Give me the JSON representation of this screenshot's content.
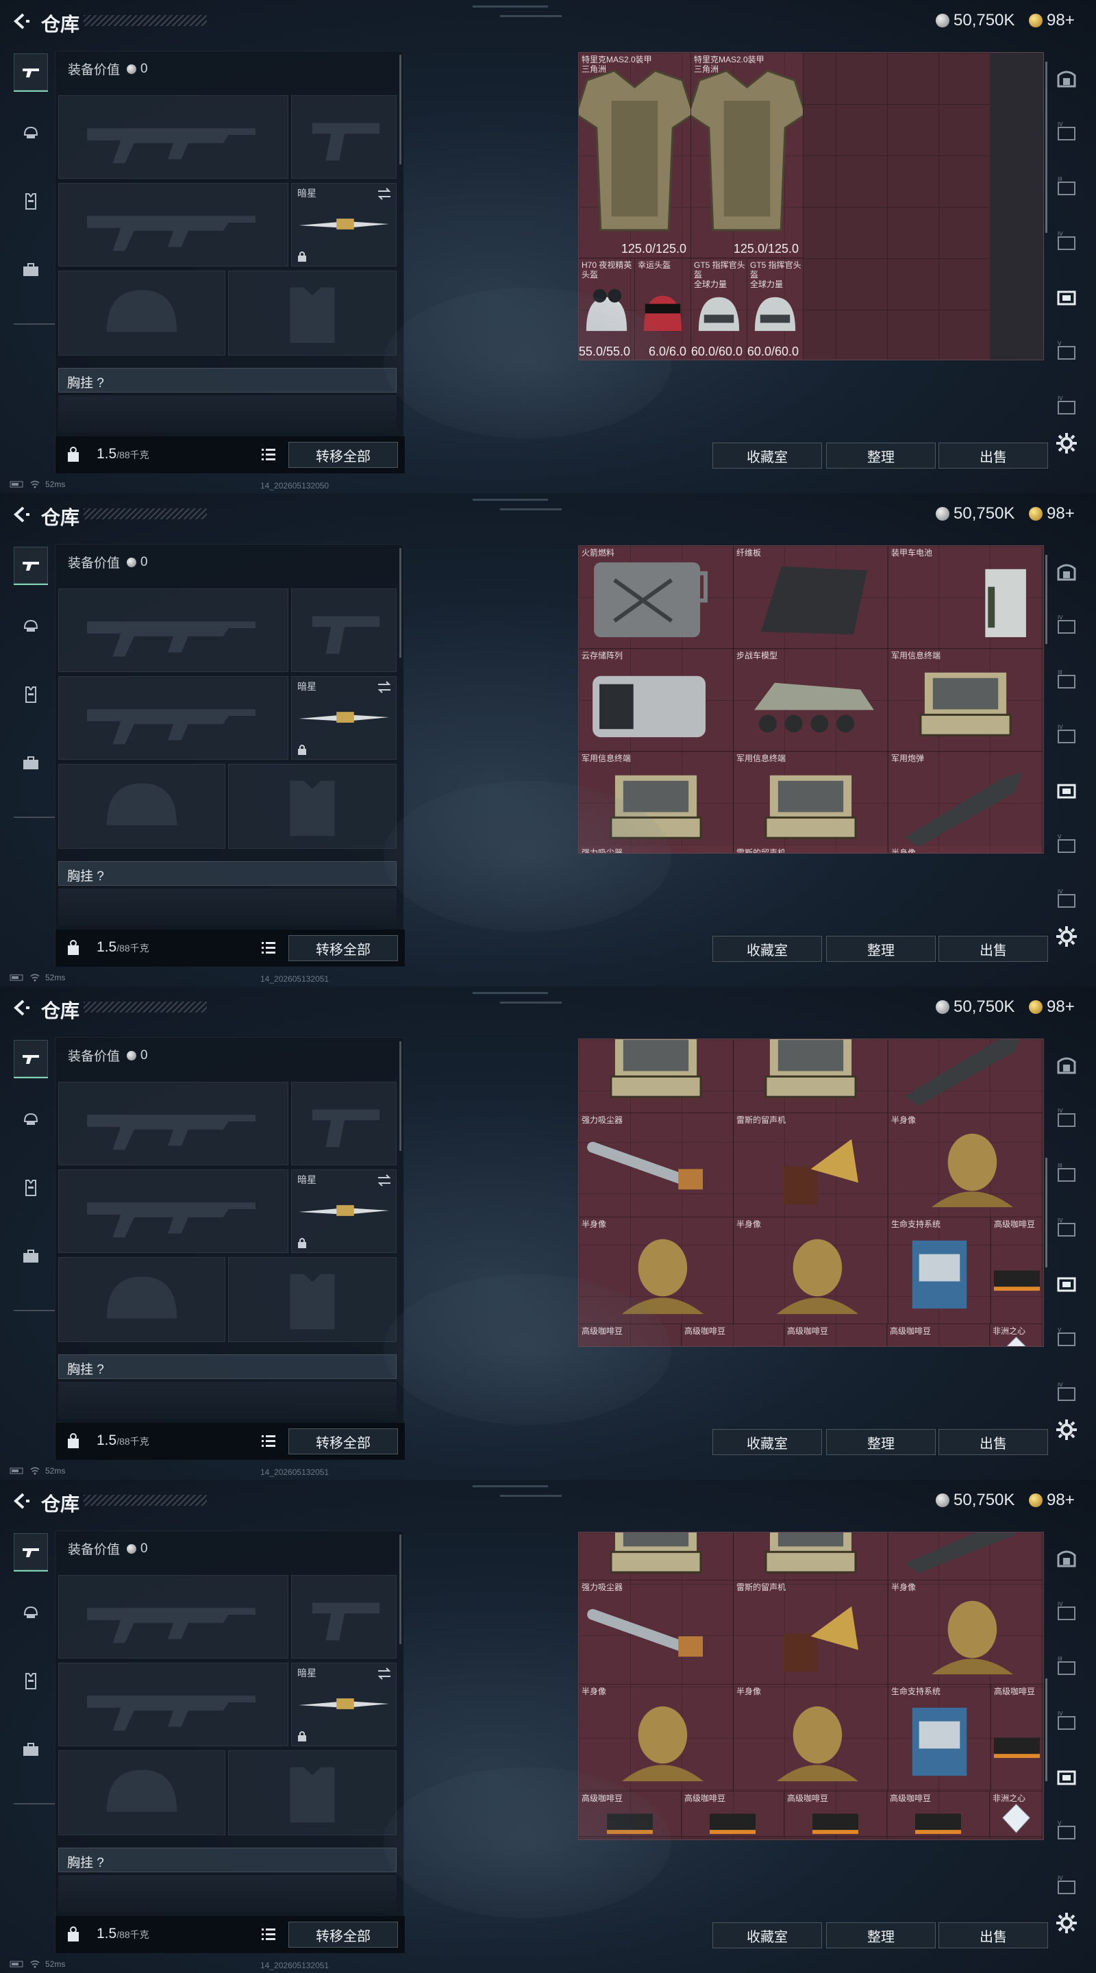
{
  "colors": {
    "grid_bg": "#4c2a33",
    "accent_green": "#7fd3b4",
    "button_bg": "#1c2630"
  },
  "topbar": {
    "title": "仓库",
    "silver": "50,750K",
    "gold": "98+"
  },
  "equipment": {
    "value_label": "装备价值",
    "value": "0",
    "slot_secondary_name": "暗星",
    "chest_label": "胸挂 ?",
    "weight_value": "1.5",
    "weight_unit": "/88千克",
    "transfer_all": "转移全部"
  },
  "actions": {
    "collection": "收藏室",
    "organize": "整理",
    "sell": "出售"
  },
  "status": {
    "ping": "52ms"
  },
  "builds": [
    "14_202605132050",
    "14_202605132051",
    "14_202605132051",
    "14_202605132051"
  ],
  "icons": {
    "back": "back-arrow-icon",
    "nav": [
      "rifle-icon",
      "helmet-icon",
      "armor-icon",
      "backpack-icon"
    ],
    "settings": "gear-icon"
  },
  "screens": [
    {
      "items": [
        {
          "name": "特里克MAS2.0装甲\n三角洲",
          "dur": "125.0/125.0",
          "art": "armor"
        },
        {
          "name": "特里克MAS2.0装甲\n三角洲",
          "dur": "125.0/125.0",
          "art": "armor"
        },
        {
          "name": "H70 夜视精英头盔",
          "dur": "55.0/55.0",
          "art": "helmet-nv"
        },
        {
          "name": "幸运头盔",
          "dur": "6.0/6.0",
          "art": "helmet-red"
        },
        {
          "name": "GT5 指挥官头盔\n全球力量",
          "dur": "60.0/60.0",
          "art": "helmet-white"
        },
        {
          "name": "GT5 指挥官头盔\n全球力量",
          "dur": "60.0/60.0",
          "art": "helmet-white"
        }
      ]
    },
    {
      "items": [
        {
          "name": "火箭燃料",
          "art": "jerrycan"
        },
        {
          "name": "纤维板",
          "art": "fiberboard"
        },
        {
          "name": "装甲车电池",
          "art": "battery"
        },
        {
          "name": "云存储阵列",
          "art": "storage"
        },
        {
          "name": "步战车模型",
          "art": "vehicle"
        },
        {
          "name": "军用信息终端",
          "art": "terminal"
        },
        {
          "name": "军用信息终端",
          "art": "terminal"
        },
        {
          "name": "军用信息终端",
          "art": "terminal"
        },
        {
          "name": "军用炮弹",
          "art": "shell"
        },
        {
          "name": "强力吸尘器",
          "art": "none"
        },
        {
          "name": "雷斯的留声机",
          "art": "none"
        },
        {
          "name": "半身像",
          "art": "none"
        }
      ]
    },
    {
      "items": [
        {
          "name": "军用信息终端",
          "art": "terminal"
        },
        {
          "name": "军用信息终端",
          "art": "terminal"
        },
        {
          "name": "军用炮弹",
          "art": "shell"
        },
        {
          "name": "强力吸尘器",
          "art": "vacuum"
        },
        {
          "name": "雷斯的留声机",
          "art": "gramophone"
        },
        {
          "name": "半身像",
          "art": "bust"
        },
        {
          "name": "半身像",
          "art": "bust"
        },
        {
          "name": "半身像",
          "art": "bust"
        },
        {
          "name": "生命支持系统",
          "art": "lifesupport"
        },
        {
          "name": "高级咖啡豆",
          "art": "coffee"
        },
        {
          "name": "高级咖啡豆",
          "art": "coffee"
        },
        {
          "name": "高级咖啡豆",
          "art": "coffee"
        },
        {
          "name": "高级咖啡豆",
          "art": "coffee"
        },
        {
          "name": "高级咖啡豆",
          "art": "coffee"
        },
        {
          "name": "非洲之心",
          "art": "diamond"
        }
      ]
    },
    {
      "items": [
        {
          "name": "",
          "art": "terminal"
        },
        {
          "name": "",
          "art": "terminal"
        },
        {
          "name": "",
          "art": "shell"
        },
        {
          "name": "强力吸尘器",
          "art": "vacuum"
        },
        {
          "name": "雷斯的留声机",
          "art": "gramophone"
        },
        {
          "name": "半身像",
          "art": "bust"
        },
        {
          "name": "半身像",
          "art": "bust"
        },
        {
          "name": "半身像",
          "art": "bust"
        },
        {
          "name": "生命支持系统",
          "art": "lifesupport"
        },
        {
          "name": "高级咖啡豆",
          "art": "coffee"
        },
        {
          "name": "高级咖啡豆",
          "art": "coffee"
        },
        {
          "name": "高级咖啡豆",
          "art": "coffee"
        },
        {
          "name": "高级咖啡豆",
          "art": "coffee"
        },
        {
          "name": "高级咖啡豆",
          "art": "coffee"
        },
        {
          "name": "非洲之心",
          "art": "diamond"
        }
      ]
    }
  ]
}
